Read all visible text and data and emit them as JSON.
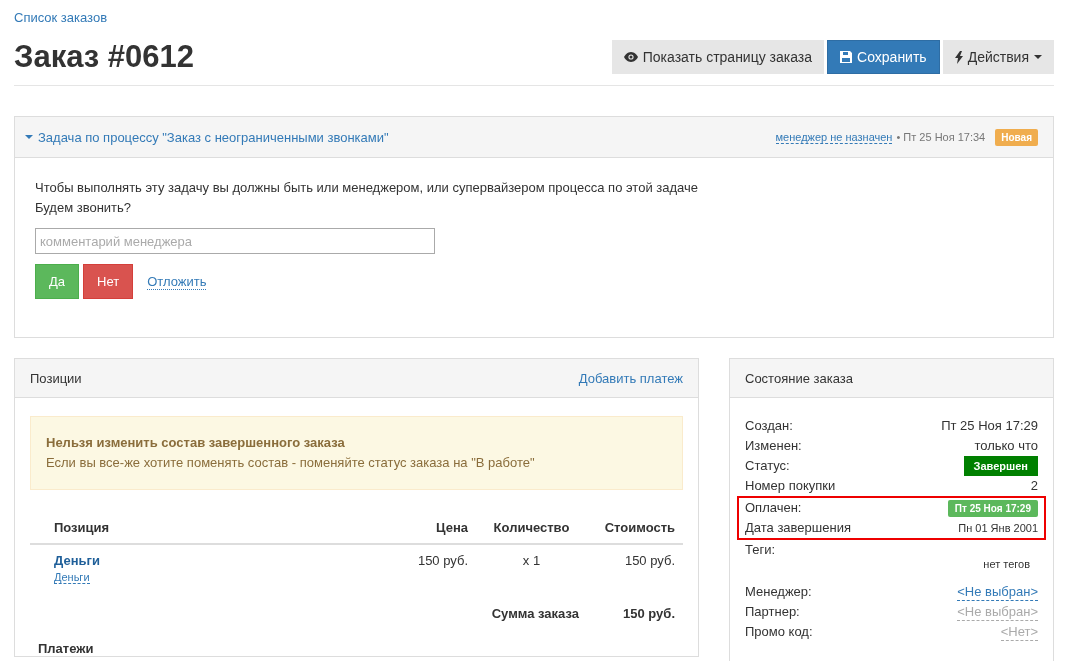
{
  "breadcrumb": "Список заказов",
  "title": "Заказ #0612",
  "actions": [
    {
      "label": "Показать страницу заказа",
      "kind": "view"
    },
    {
      "label": "Сохранить",
      "kind": "save"
    },
    {
      "label": "Действия",
      "kind": "menu"
    }
  ],
  "task": {
    "title": "Задача по процессу \"Заказ с неограниченными звонками\"",
    "expanded": true,
    "manager": "менеджер не назначен",
    "time": "• Пт 25 Ноя 17:34",
    "badge": "Новая",
    "message": "Чтобы выполнять эту задачу вы должны быть или менеджером, или супервайзером процесса по этой задаче",
    "question": "Будем звонить?",
    "comment": {
      "placeholder": "комментарий менеджера"
    },
    "buttons": [
      {
        "label": "Да",
        "kind": "yes"
      },
      {
        "label": "Нет",
        "kind": "no"
      },
      {
        "label": "Отложить",
        "kind": "link"
      }
    ]
  },
  "positions": {
    "title": "Позиции",
    "action": "Добавить платеж",
    "alert": {
      "title": "Нельзя изменить состав завершенного заказа",
      "text": "Если вы все-же хотите поменять состав - поменяйте статус заказа на \"В работе\""
    },
    "columns": [
      "Позиция",
      "Цена",
      "Количество",
      "Стоимость"
    ],
    "rows": [
      {
        "name": "Деньги",
        "sub": "Деньги",
        "price": "150 руб.",
        "qty": "x 1",
        "cost": "150 руб."
      }
    ],
    "total_label": "Сумма заказа",
    "total": "150 руб.",
    "payments_heading": "Платежи"
  },
  "status": {
    "title": "Состояние заказа",
    "rows": [
      {
        "label": "Создан:",
        "value": "Пт 25 Ноя 17:29",
        "kind": "text",
        "highlighted": false
      },
      {
        "label": "Изменен:",
        "value": "только что",
        "kind": "text",
        "highlighted": false
      },
      {
        "label": "Статус:",
        "value": "Завершен",
        "kind": "badge",
        "highlighted": false
      },
      {
        "label": "Номер покупки",
        "value": "2",
        "kind": "text",
        "highlighted": false
      },
      {
        "label": "Оплачен:",
        "value": "Пт 25 Ноя 17:29",
        "kind": "badge-light",
        "highlighted": true
      },
      {
        "label": "Дата завершения",
        "value": "Пн 01 Янв 2001",
        "kind": "small",
        "highlighted": true
      },
      {
        "label": "Теги:",
        "value": "нет тегов",
        "kind": "tags",
        "highlighted": false
      },
      {
        "label": "Менеджер:",
        "value": "<Не выбран>",
        "kind": "link",
        "highlighted": false
      },
      {
        "label": "Партнер:",
        "value": "<Не выбран>",
        "kind": "muted-link",
        "highlighted": false
      },
      {
        "label": "Промо код:",
        "value": "<Нет>",
        "kind": "muted-link",
        "highlighted": false
      }
    ]
  }
}
